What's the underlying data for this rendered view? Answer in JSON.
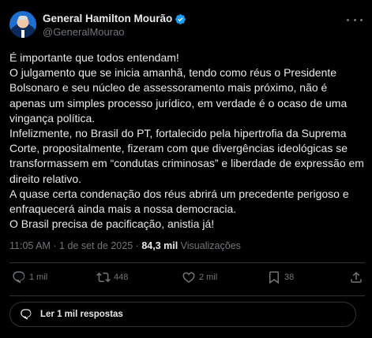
{
  "author": {
    "display_name": "General Hamilton Mourão",
    "handle": "@GeneralMourao",
    "verified": true
  },
  "post": {
    "paragraphs": [
      "É importante que todos entendam!",
      "O julgamento que se inicia amanhã, tendo como réus o Presidente Bolsonaro e seu núcleo de assessoramento mais próximo, não é apenas um simples processo jurídico, em verdade é o ocaso de uma vingança política.",
      "Infelizmente, no Brasil do PT, fortalecido pela hipertrofia da Suprema Corte, propositalmente, fizeram com que divergências ideológicas se transformassem em “condutas criminosas” e liberdade de expressão em direito relativo.",
      "A quase certa condenação dos réus abrirá um precedente perigoso e enfraquecerá ainda mais a nossa democracia.",
      "O Brasil precisa de pacificação, anistia já!"
    ],
    "time": "11:05 AM",
    "separator": "·",
    "date": "1 de set de 2025",
    "views_count": "84,3 mil",
    "views_label": "Visualizações"
  },
  "actions": {
    "replies": "1 mil",
    "reposts": "448",
    "likes": "2 mil",
    "views": "38"
  },
  "read_replies": {
    "label": "Ler 1 mil respostas"
  },
  "colors": {
    "background": "#000000",
    "text": "#e7e9ea",
    "muted": "#71767b",
    "border": "#2f3336",
    "verified": "#1d9bf0"
  },
  "icons": [
    "more-icon",
    "verified-badge-icon",
    "reply-icon",
    "repost-icon",
    "like-icon",
    "views-icon",
    "bookmark-icon",
    "share-icon",
    "reply-bubble-icon"
  ]
}
